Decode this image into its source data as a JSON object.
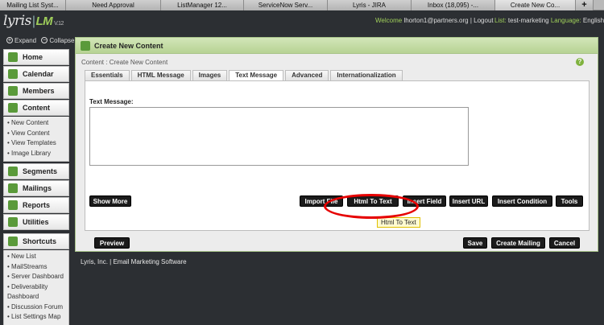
{
  "browser_tabs": [
    {
      "label": "Mailing List Syst...",
      "active": false
    },
    {
      "label": "Need Approval",
      "active": false
    },
    {
      "label": "ListManager 12...",
      "active": false
    },
    {
      "label": "ServiceNow Serv...",
      "active": false
    },
    {
      "label": "Lyris - JIRA",
      "active": false
    },
    {
      "label": "Inbox (18,095) -...",
      "active": false
    },
    {
      "label": "Create New Co...",
      "active": true
    }
  ],
  "browser_new_tab": "+",
  "logo": {
    "brand": "lyris",
    "separator": "|",
    "product": "LM",
    "version": "V.12"
  },
  "header": {
    "welcome_prefix": "Welcome",
    "user": "lhorton1@partners.org",
    "divider": "|",
    "logout": "Logout",
    "list_label": "List:",
    "list_name": "test-marketing",
    "language_label": "Language:",
    "language": "English"
  },
  "expand_label": "Expand",
  "collapse_label": "Collapse",
  "sidebar": {
    "home": "Home",
    "calendar": "Calendar",
    "members": "Members",
    "content": "Content",
    "content_items": [
      "New Content",
      "View Content",
      "View Templates",
      "Image Library"
    ],
    "segments": "Segments",
    "mailings": "Mailings",
    "reports": "Reports",
    "utilities": "Utilities",
    "shortcuts": "Shortcuts",
    "shortcut_items": [
      "New List",
      "MailStreams",
      "Server Dashboard",
      "Deliverability Dashboard",
      "Discussion Forum",
      "List Settings Map"
    ]
  },
  "panel": {
    "title": "Create New Content",
    "breadcrumb": "Content : Create New Content",
    "help": "?",
    "tabs": [
      "Essentials",
      "HTML Message",
      "Images",
      "Text Message",
      "Advanced",
      "Internationalization"
    ],
    "active_tab": "Text Message",
    "text_message_label": "Text Message:",
    "text_message_value": ""
  },
  "buttons": {
    "show_more": "Show More",
    "import_file": "Import File",
    "html_to_text": "Html To Text",
    "insert_field": "Insert Field",
    "insert_url": "Insert URL",
    "insert_condition": "Insert Condition",
    "tools": "Tools",
    "preview": "Preview",
    "save": "Save",
    "create_mailing": "Create Mailing",
    "cancel": "Cancel"
  },
  "tooltip": "Html To Text",
  "footer": "Lyris, Inc. | Email Marketing Software",
  "colors": {
    "accent_green": "#9fce5a",
    "highlight_circle": "#e60000",
    "tooltip_bg": "#fffbd0"
  }
}
